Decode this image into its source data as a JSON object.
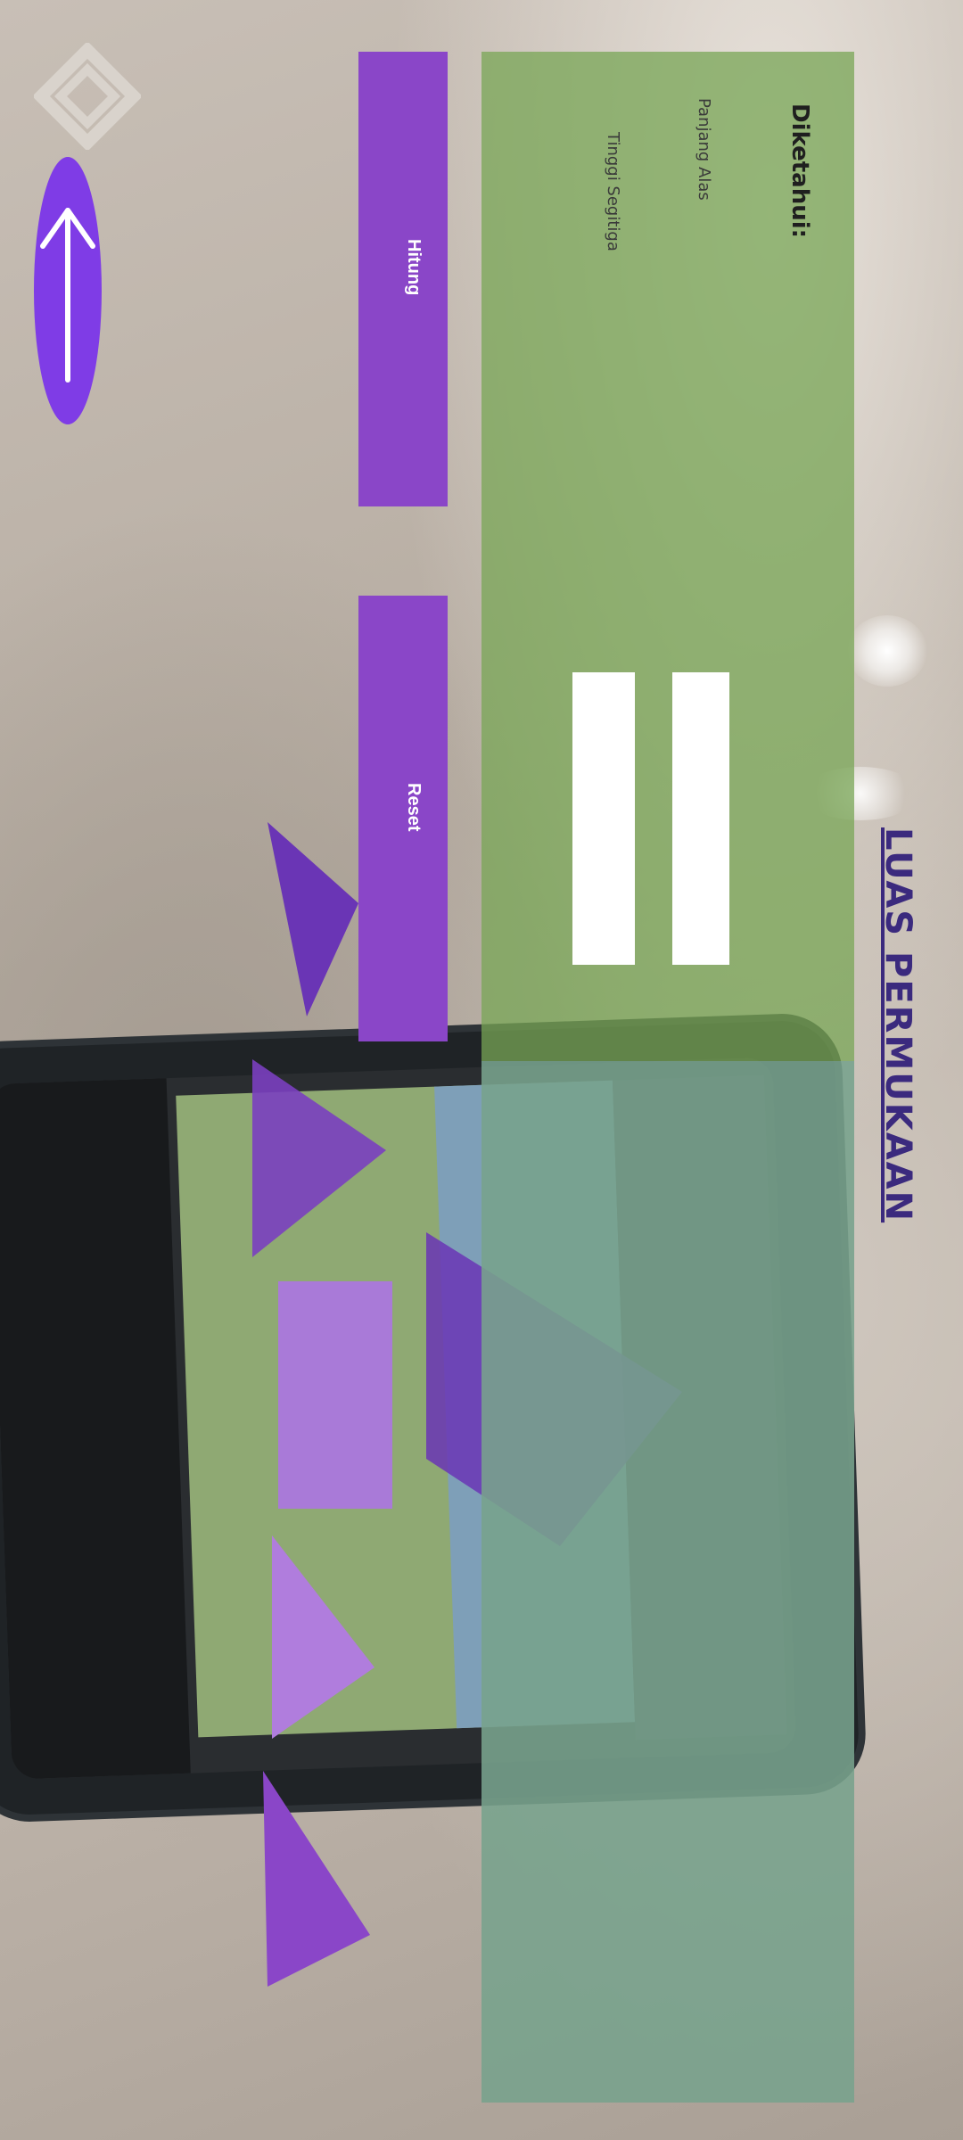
{
  "screen": {
    "title": "LUAS PERMUKAAN"
  },
  "form": {
    "heading": "Diketahui:",
    "fields": [
      {
        "label": "Panjang Alas",
        "value": ""
      },
      {
        "label": "Tinggi Segitiga",
        "value": ""
      }
    ]
  },
  "buttons": {
    "hitung": "Hitung",
    "reset": "Reset"
  },
  "navigation": {
    "back_icon": "arrow-left-icon"
  },
  "colors": {
    "accent": "#8a46c8",
    "title": "#3b2a7e",
    "panel": "#78a555",
    "shape_dark": "#6a35b5",
    "shape_light": "#b07ddd"
  }
}
